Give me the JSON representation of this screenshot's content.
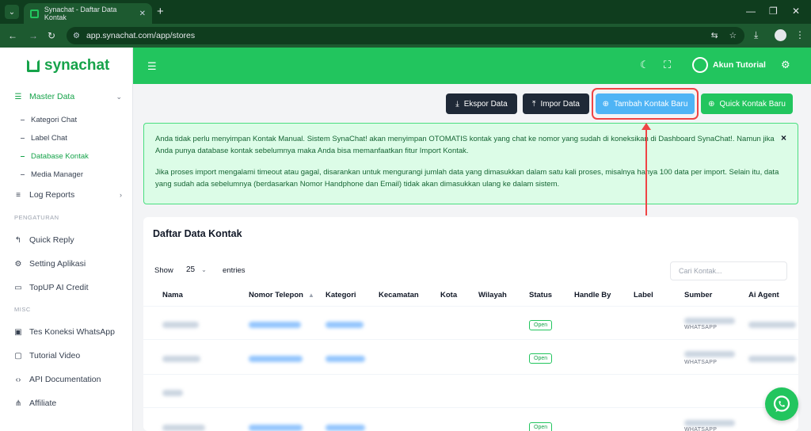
{
  "browser": {
    "tab_title": "Synachat - Daftar Data Kontak",
    "url": "app.synachat.com/app/stores"
  },
  "sidebar": {
    "logo": "synachat",
    "master_data": "Master Data",
    "sub_items": [
      "Kategori Chat",
      "Label Chat",
      "Database Kontak",
      "Media Manager"
    ],
    "log_reports": "Log Reports",
    "section_pengaturan": "PENGATURAN",
    "quick_reply": "Quick Reply",
    "setting_aplikasi": "Setting Aplikasi",
    "topup": "TopUP AI Credit",
    "section_misc": "MISC",
    "tes_koneksi": "Tes Koneksi WhatsApp",
    "tutorial_video": "Tutorial Video",
    "api_docs": "API Documentation",
    "affiliate": "Affiliate"
  },
  "header": {
    "user_name": "Akun Tutorial"
  },
  "actions": {
    "ekspor": "Ekspor Data",
    "impor": "Impor Data",
    "tambah": "Tambah Kontak Baru",
    "quick": "Quick Kontak Baru"
  },
  "alert": {
    "p1": "Anda tidak perlu menyimpan Kontak Manual. Sistem SynaChat! akan menyimpan OTOMATIS kontak yang chat ke nomor yang sudah di koneksikan di Dashboard SynaChat!. Namun jika Anda punya database kontak sebelumnya maka Anda bisa memanfaatkan fitur Import Kontak.",
    "p2": "Jika proses import mengalami timeout atau gagal, disarankan untuk mengurangi jumlah data yang dimasukkan dalam satu kali proses, misalnya hanya 100 data per import. Selain itu, data yang sudah ada sebelumnya (berdasarkan Nomor Handphone dan Email) tidak akan dimasukkan ulang ke dalam sistem.",
    "close": "×"
  },
  "table": {
    "title": "Daftar Data Kontak",
    "show_label": "Show",
    "entries_value": "25",
    "entries_label": "entries",
    "search_placeholder": "Cari Kontak...",
    "columns": [
      "Nama",
      "Nomor Telepon",
      "Kategori",
      "Kecamatan",
      "Kota",
      "Wilayah",
      "Status",
      "Handle By",
      "Label",
      "Sumber",
      "Ai Agent"
    ],
    "status_label": "Open",
    "source_label": "WHATSAPP"
  },
  "colors": {
    "brand_green": "#22c55e",
    "accent_blue": "#4fb4f5",
    "annotation_red": "#ef4444"
  }
}
